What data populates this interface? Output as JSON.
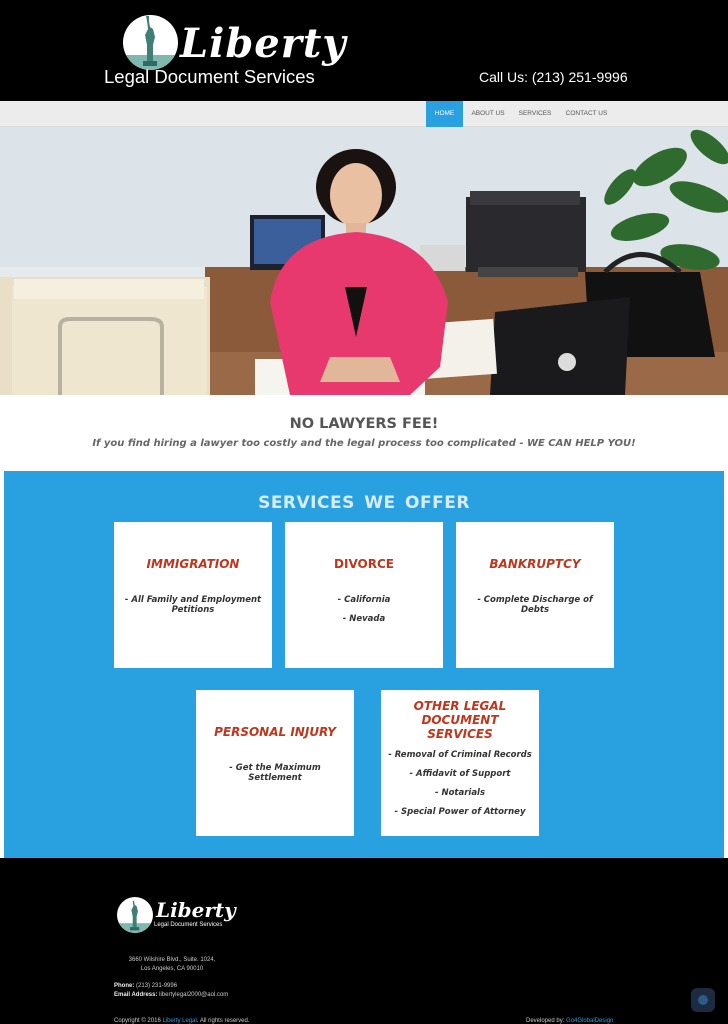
{
  "header": {
    "brand": "Liberty",
    "tagline": "Legal Document Services",
    "call": "Call Us: (213) 251-9996"
  },
  "nav": {
    "items": [
      {
        "label": "HOME",
        "active": true
      },
      {
        "label": "ABOUT US",
        "active": false
      },
      {
        "label": "SERVICES",
        "active": false
      },
      {
        "label": "CONTACT US",
        "active": false
      }
    ]
  },
  "intro": {
    "title": "NO LAWYERS FEE!",
    "subtitle": "If you find hiring a lawyer too costly and the legal process too complicated - WE CAN HELP YOU!"
  },
  "services": {
    "title": "SERVICES  WE  OFFER",
    "cards": [
      {
        "title": "IMMIGRATION",
        "items": [
          "- All Family and Employment Petitions"
        ]
      },
      {
        "title": "DIVORCE",
        "items": [
          "- California",
          "- Nevada"
        ]
      },
      {
        "title": "BANKRUPTCY",
        "items": [
          "- Complete Discharge of Debts"
        ]
      },
      {
        "title": "PERSONAL INJURY",
        "items": [
          "- Get the Maximum Settlement"
        ]
      },
      {
        "title": "OTHER LEGAL DOCUMENT SERVICES",
        "items": [
          "- Removal of Criminal Records",
          "- Affidavit of Support",
          "- Notarials",
          "- Special Power of Attorney"
        ]
      }
    ]
  },
  "footer": {
    "brand": "Liberty",
    "tagline": "Legal Document Services",
    "address_line1": "3660 Wilshire Blvd., Suite. 1024,",
    "address_line2": "Los Angeles, CA 90010",
    "phone_label": "Phone:",
    "phone": "(213) 231-9996",
    "email_label": "Email Address:",
    "email": "libertylegal2000@aol.com",
    "copyright_prefix": "Copyright © 2016",
    "copyright_link": "Liberty Legal",
    "copyright_suffix": ". All rights reserved.",
    "developed_prefix": "Developed by:",
    "developed_link": "Go4GlobalDesign"
  },
  "colors": {
    "accent": "#29a0e0",
    "card_title": "#c0351c",
    "header_bg": "#000000"
  }
}
